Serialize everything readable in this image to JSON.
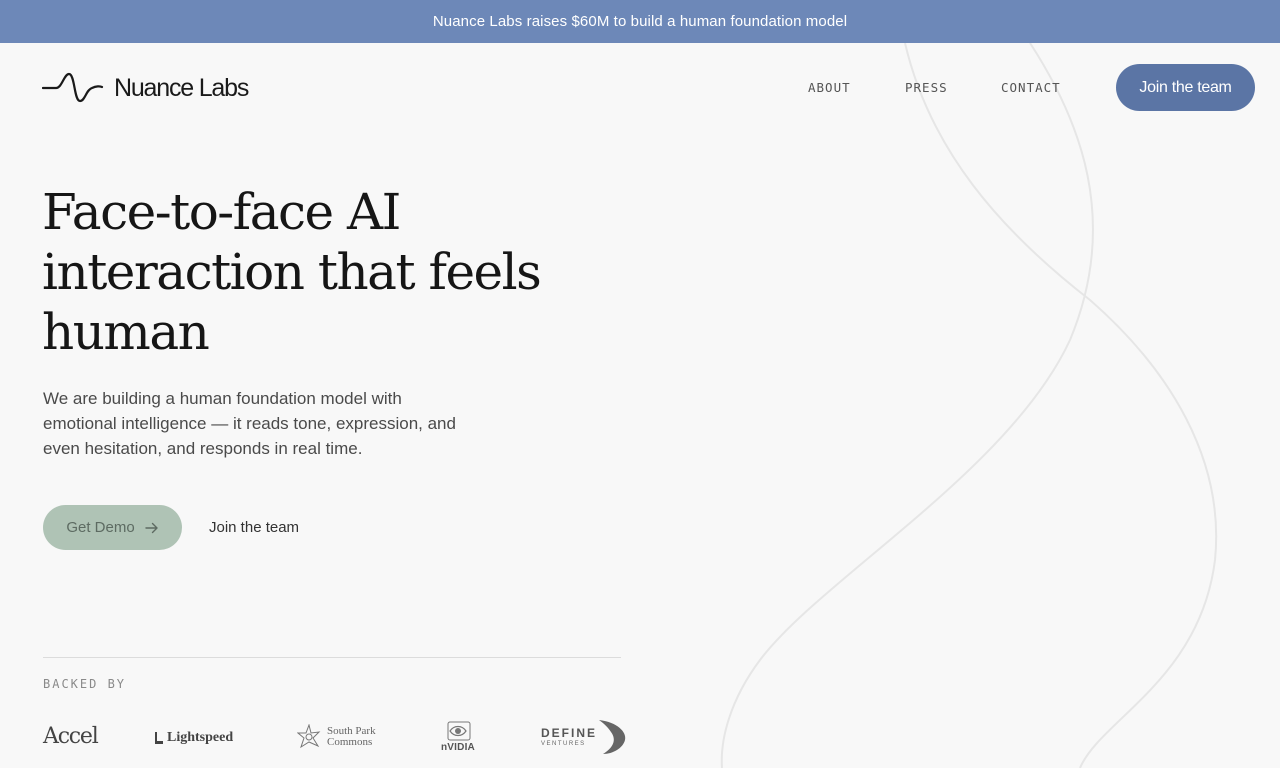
{
  "banner": {
    "text": "Nuance Labs raises $60M to build a human foundation model"
  },
  "header": {
    "logo_text": "Nuance Labs",
    "nav": [
      {
        "label": "ABOUT"
      },
      {
        "label": "PRESS"
      },
      {
        "label": "CONTACT"
      }
    ],
    "cta_label": "Join the team"
  },
  "hero": {
    "headline": "Face-to-face AI interaction that feels human",
    "subtext": "We are building a human foundation model with emotional intelligence — it reads tone, expression, and even hesitation, and responds in real time.",
    "primary_cta": "Get Demo",
    "primary_cta_icon": "arrow-right-icon",
    "secondary_cta": "Join the team"
  },
  "investors": {
    "label": "BACKED BY",
    "logos": [
      {
        "name": "Accel"
      },
      {
        "name": "Lightspeed"
      },
      {
        "name": "South Park Commons",
        "line1": "South Park",
        "line2": "Commons"
      },
      {
        "name": "NVIDIA",
        "text": "nVIDIA"
      },
      {
        "name": "Define Ventures",
        "main": "DEFINE",
        "sub": "VENTURES"
      }
    ]
  },
  "colors": {
    "banner_bg": "#6d88b8",
    "primary_button": "#5b75a5",
    "demo_button": "#afc3b5",
    "page_bg": "#f8f8f8"
  }
}
